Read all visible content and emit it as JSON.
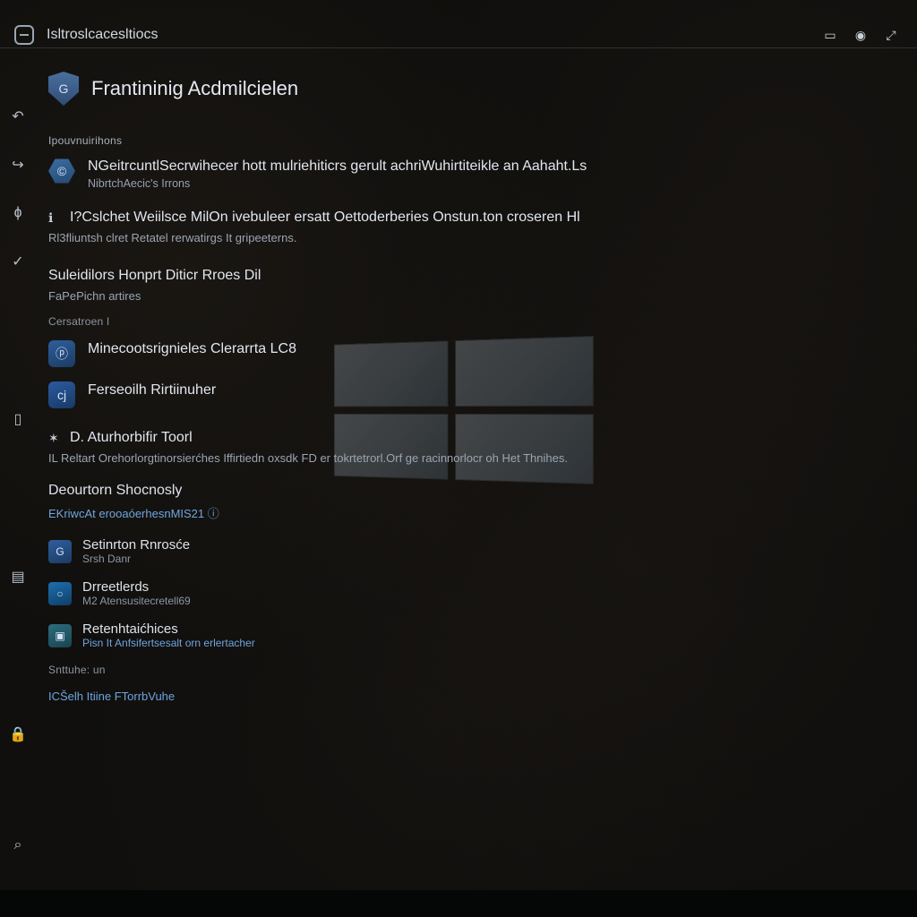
{
  "titlebar": {
    "title": "Isltroslcacesltiocs",
    "sys_icons": [
      "min",
      "max",
      "close"
    ]
  },
  "rail": {
    "items": [
      {
        "name": "back-icon",
        "glyph": "↶"
      },
      {
        "name": "share-icon",
        "glyph": "↪"
      },
      {
        "name": "flame-icon",
        "glyph": "ɸ"
      },
      {
        "name": "check-icon",
        "glyph": "✓"
      },
      {
        "name": "page-icon",
        "glyph": "▯"
      },
      {
        "name": "clipboard-icon",
        "glyph": "▤"
      },
      {
        "name": "lock-icon",
        "glyph": "🔒"
      }
    ],
    "bottom": {
      "name": "search-icon",
      "glyph": "⌕"
    }
  },
  "header": {
    "title": "Frantininig Acdmilcielen",
    "shield_letter": "G"
  },
  "sections": {
    "label1": "Ipouvnuirihons",
    "entry1": {
      "title": "NGeitrcuntlSecrwihecer hott mulriehiticrs gerult achriWuhirtiteikle an Aahaht.Ls",
      "sub": "NibrtchAecic's Irrons"
    },
    "sub2": {
      "title": "I?Cslchet Weiilsce MilOn ivebuleer ersatt Oettoderberies Onstun.ton croseren Hl",
      "desc": "Rl3fliuntsh clret Retatel rerwatirgs It gripeeterns."
    },
    "sub3": {
      "title": "Suleidilors Honprt Diticr Rroes Dil",
      "desc": "FaPePichn artires"
    },
    "caption": "Cersatroen I",
    "entry4": {
      "title": "Minecootsrignieles Clerarrta LC8"
    },
    "entry5": {
      "title": "Ferseoilh Rirtiinuher"
    },
    "sub6": {
      "title": "D. Aturhorbifir Toorl",
      "desc": "IL Reltart Orehorlorgtinorsierćhes Iffirtiedn oxsdk FD er tokrtetrorl.Orf ge racinnorlocr oh Het Thnihes."
    },
    "group": {
      "head": "Deourtorn Shocnosly",
      "link": "EKriwcAt erooaóerhesnMIS21 ⓘ"
    },
    "list": [
      {
        "title": "Setinrton Rnrosće",
        "sub": "Srsh Danr",
        "icon_bg": "bg-blue2",
        "glyph": "G"
      },
      {
        "title": "Drreetlerds",
        "sub": "M2 Atensusitecretell69",
        "icon_bg": "bg-cyan",
        "glyph": "○"
      },
      {
        "title": "Retenhtaićhices",
        "sub": "Pisn It Anfsifertsesalt orn erlertacher",
        "sub_link": true,
        "icon_bg": "bg-teal",
        "glyph": "▣"
      }
    ],
    "footer": {
      "small": "Snttuhe: un",
      "line": "ICŠelh Itiine FTorrbVuhe"
    }
  }
}
